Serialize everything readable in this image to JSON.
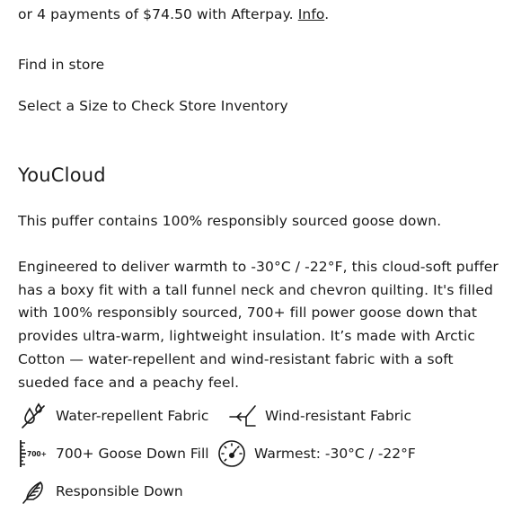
{
  "payments": {
    "text": "or 4 payments of $74.50 with Afterpay. ",
    "link": "Info",
    "suffix": "."
  },
  "store": {
    "find_label": "Find in store",
    "select_prompt": "Select a Size to Check Store Inventory"
  },
  "product": {
    "name": "YouCloud",
    "summary": "This puffer contains 100% responsibly sourced goose down.",
    "description": "Engineered to deliver warmth to -30°C / -22°F, this cloud-soft puffer has a boxy fit with a tall funnel neck and chevron quilting. It's filled with 100% responsibly sourced, 700+ fill power goose down that provides ultra-warm, lightweight insulation. It’s made with Arctic Cotton — water-repellent and wind-resistant fabric with a soft sueded face and a peachy feel."
  },
  "features": [
    {
      "icon": "water-drop-icon",
      "label": "Water-repellent Fabric"
    },
    {
      "icon": "wind-icon",
      "label": "Wind-resistant Fabric"
    },
    {
      "icon": "fill-power-icon",
      "icon_text": "700+",
      "label": "700+ Goose Down Fill"
    },
    {
      "icon": "gauge-icon",
      "label": "Warmest: -30°C / -22°F"
    },
    {
      "icon": "feather-icon",
      "label": "Responsible Down"
    }
  ]
}
